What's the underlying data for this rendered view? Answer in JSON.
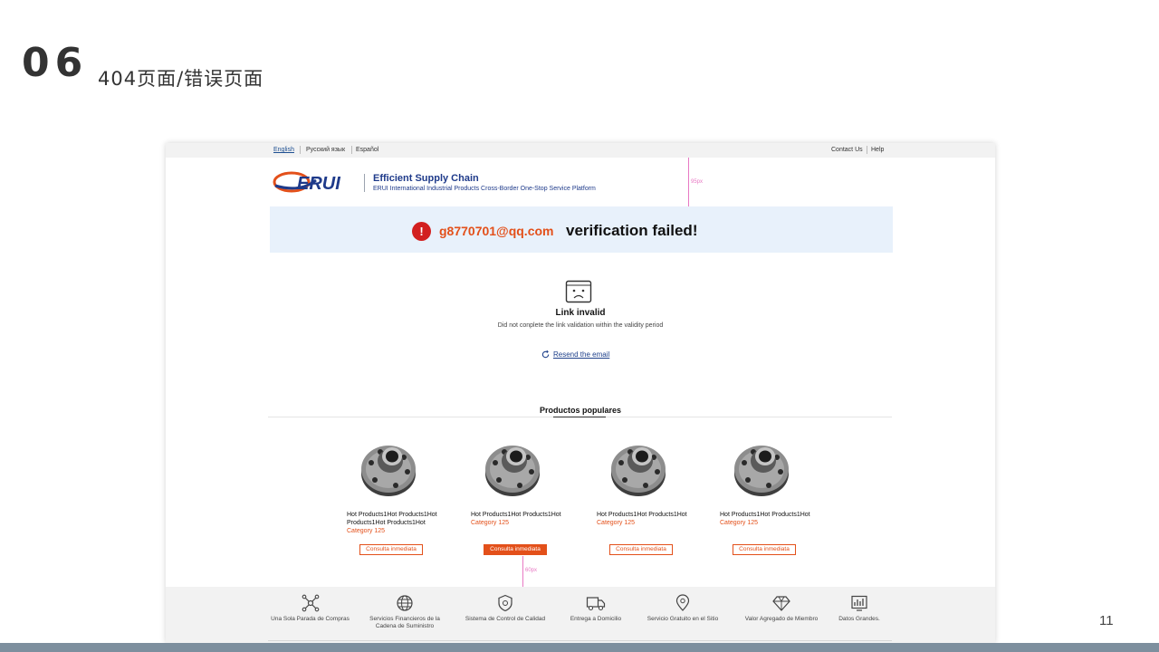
{
  "slide": {
    "number": "06",
    "title": "404页面/错误页面",
    "page_number": "11"
  },
  "topbar": {
    "languages": [
      "English",
      "Русский язык",
      "Español"
    ],
    "links": [
      "Contact Us",
      "Help"
    ]
  },
  "brand": {
    "logo_text": "ERUI",
    "title": "Efficient Supply Chain",
    "subtitle": "ERUI International Industrial Products Cross-Border One-Stop Service Platform"
  },
  "annotations": {
    "header_gap": "95px",
    "bottom_gap": "60px"
  },
  "alert": {
    "email": "g8770701@qq.com",
    "message": "verification failed!"
  },
  "status": {
    "title": "Link invalid",
    "description": "Did not conplete the link validation within the validity period",
    "resend_label": "Resend the email"
  },
  "products": {
    "heading": "Productos populares",
    "items": [
      {
        "name": "Hot Products1Hot Products1Hot Products1Hot Products1Hot",
        "category": "Category   125",
        "button": "Consulta inmediata"
      },
      {
        "name": "Hot Products1Hot Products1Hot",
        "category": "Category   125",
        "button": "Consulta inmediata"
      },
      {
        "name": "Hot Products1Hot Products1Hot",
        "category": "Category   125",
        "button": "Consulta inmediata"
      },
      {
        "name": "Hot Products1Hot Products1Hot",
        "category": "Category   125",
        "button": "Consulta inmediata"
      }
    ]
  },
  "footer": {
    "items": [
      {
        "icon": "network-icon",
        "label": "Una Sola Parada de Compras"
      },
      {
        "icon": "globe-icon",
        "label": "Servicios Financieros de la Cadena de Suministro"
      },
      {
        "icon": "shield-icon",
        "label": "Sistema de Control de Calidad"
      },
      {
        "icon": "truck-icon",
        "label": "Entrega a Domicilio"
      },
      {
        "icon": "location-pin-icon",
        "label": "Servicio Gratuito en el Sitio"
      },
      {
        "icon": "diamond-icon",
        "label": "Valor Agregado de Miembro"
      },
      {
        "icon": "chart-icon",
        "label": "Datos Grandes."
      }
    ]
  },
  "colors": {
    "accent": "#e3501a",
    "brand_blue": "#1e3a8a",
    "alert_bg": "#e8f1fb",
    "error_red": "#d21f1f"
  }
}
